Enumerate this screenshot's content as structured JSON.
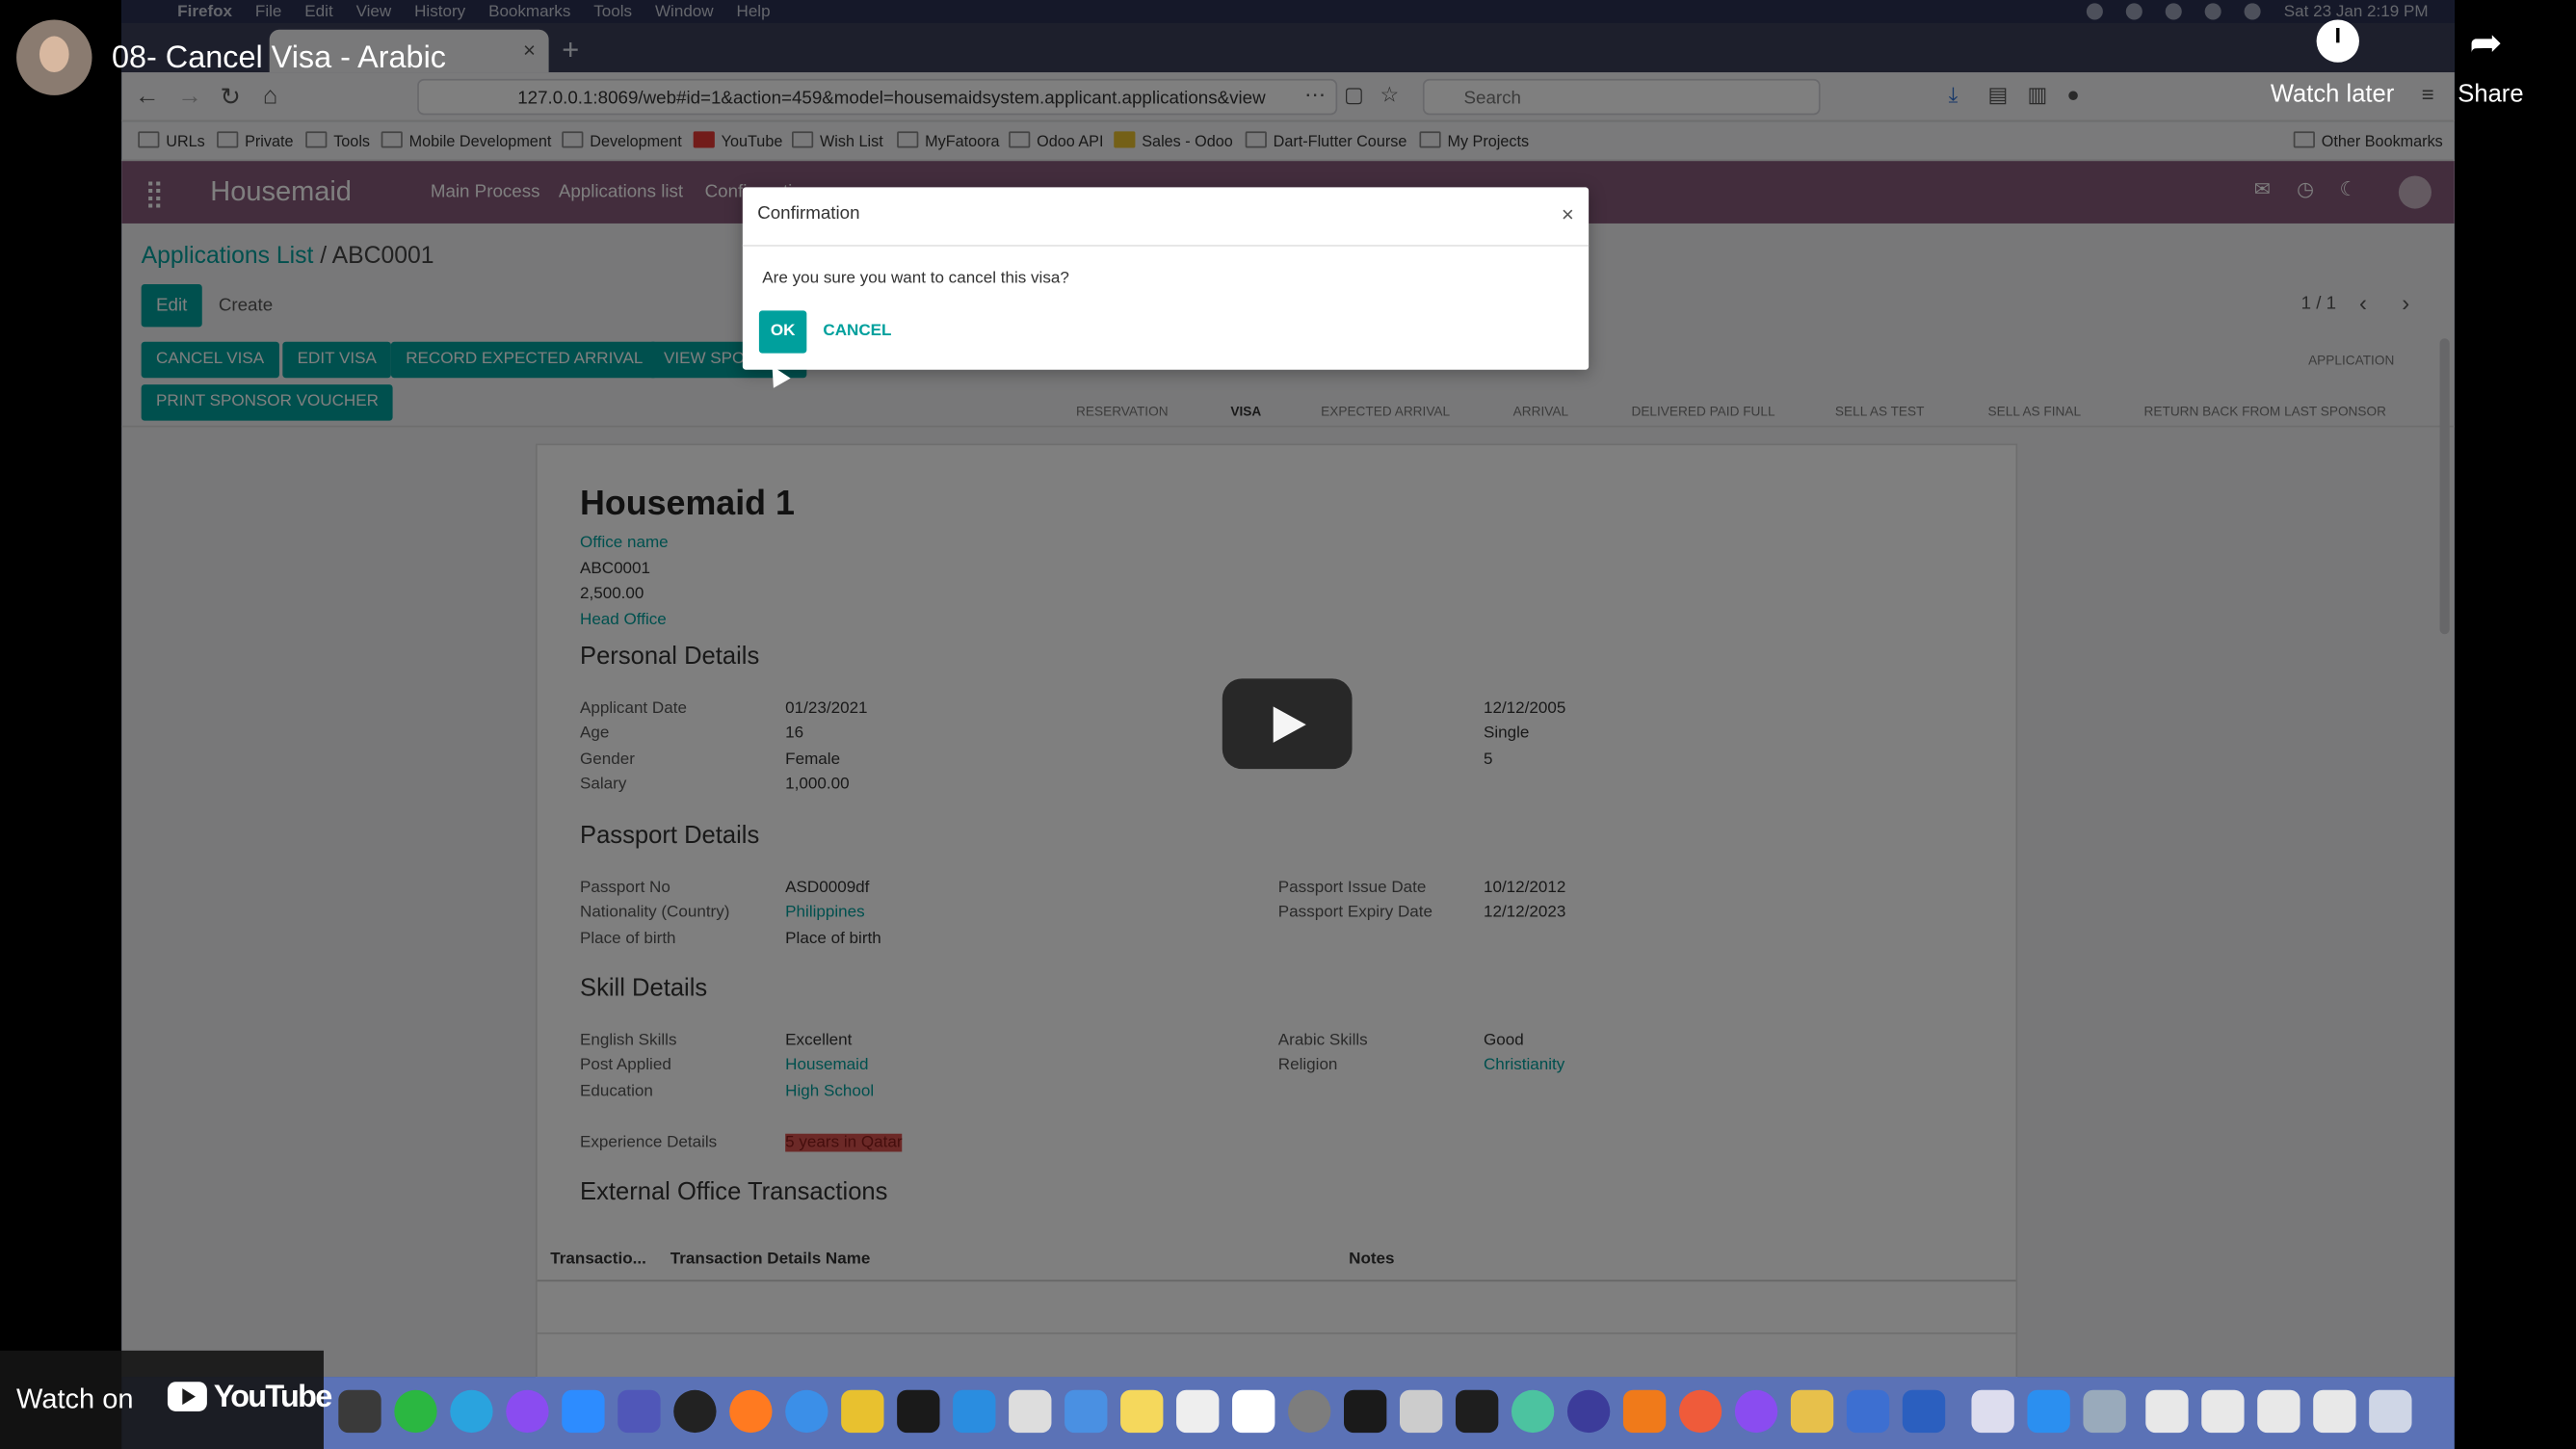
{
  "youtube": {
    "title": "08- Cancel Visa - Arabic",
    "watch_later": "Watch later",
    "share": "Share",
    "watch_on": "Watch on",
    "logo_text": "YouTube"
  },
  "mac_menu": {
    "app": "Firefox",
    "items": [
      "File",
      "Edit",
      "View",
      "History",
      "Bookmarks",
      "Tools",
      "Window",
      "Help"
    ],
    "datetime": "Sat 23 Jan  2:19 PM"
  },
  "browser": {
    "url": "127.0.0.1:8069/web#id=1&action=459&model=housemaidsystem.applicant.applications&view",
    "search_placeholder": "Search",
    "bookmarks": [
      "URLs",
      "Private",
      "Tools",
      "Mobile Development",
      "Development",
      "YouTube",
      "Wish List",
      "MyFatoora",
      "Odoo API",
      "Sales - Odoo",
      "Dart-Flutter Course",
      "My Projects"
    ],
    "other_bookmarks": "Other Bookmarks"
  },
  "app": {
    "brand": "Housemaid",
    "menu": [
      "Main Process",
      "Applications list",
      "Configuration"
    ],
    "breadcrumb_parent": "Applications List",
    "breadcrumb_sep": "/",
    "breadcrumb_current": "ABC0001",
    "edit": "Edit",
    "create": "Create",
    "pager": "1 / 1",
    "actions": [
      "CANCEL VISA",
      "EDIT VISA",
      "RECORD EXPECTED ARRIVAL",
      "VIEW SPONSOR"
    ],
    "print_voucher": "PRINT SPONSOR VOUCHER",
    "stages_top": "APPLICATION",
    "stages": [
      "RESERVATION",
      "VISA",
      "EXPECTED ARRIVAL",
      "ARRIVAL",
      "DELIVERED PAID FULL",
      "SELL AS TEST",
      "SELL AS FINAL",
      "RETURN BACK FROM LAST SPONSOR"
    ]
  },
  "record": {
    "name": "Housemaid 1",
    "office_label": "Office name",
    "code": "ABC0001",
    "amount": "2,500.00",
    "office": "Head Office",
    "personal_title": "Personal Details",
    "applicant_date_label": "Applicant Date",
    "applicant_date": "01/23/2021",
    "age_label": "Age",
    "age": "16",
    "gender_label": "Gender",
    "gender": "Female",
    "salary_label": "Salary",
    "salary": "1,000.00",
    "birth_date": "12/12/2005",
    "marital_status": "Single",
    "kids": "5",
    "passport_title": "Passport Details",
    "passport_no_label": "Passport No",
    "passport_no": "ASD0009df",
    "nationality_label": "Nationality (Country)",
    "nationality": "Philippines",
    "place_label": "Place of birth",
    "place": "Place of birth",
    "issue_label": "Passport Issue Date",
    "issue": "10/12/2012",
    "expiry_label": "Passport Expiry Date",
    "expiry": "12/12/2023",
    "skill_title": "Skill Details",
    "english_label": "English Skills",
    "english": "Excellent",
    "post_label": "Post Applied",
    "post": "Housemaid",
    "education_label": "Education",
    "education": "High School",
    "arabic_label": "Arabic Skills",
    "arabic": "Good",
    "religion_label": "Religion",
    "religion": "Christianity",
    "experience_label": "Experience Details",
    "experience": "5 years in Qatar",
    "transactions_title": "External Office Transactions",
    "col1": "Transactio...",
    "col2": "Transaction Details Name",
    "col3": "Notes"
  },
  "dialog": {
    "title": "Confirmation",
    "close": "×",
    "message": "Are you sure you want to cancel this visa?",
    "ok": "OK",
    "cancel": "CANCEL"
  },
  "colors": {
    "accent": "#00a09d",
    "navbar": "#875a7b"
  }
}
